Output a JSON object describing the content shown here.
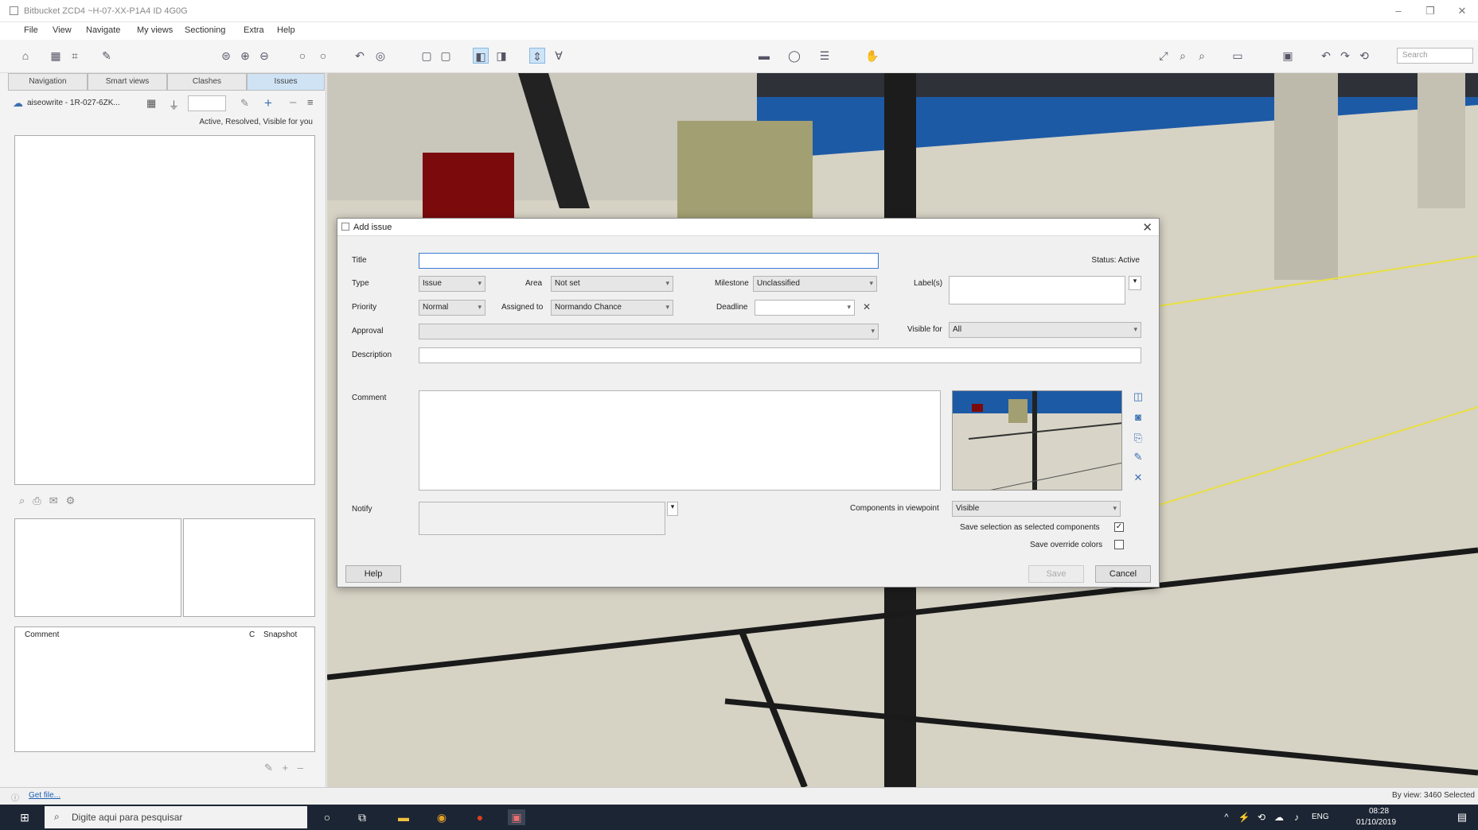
{
  "window": {
    "title": "Bitbucket ZCD4 ~H-07-XX-P1A4 ID 4G0G"
  },
  "menu": [
    "File",
    "View",
    "Navigate",
    "My views",
    "Sectioning",
    "Extra",
    "Help"
  ],
  "toolbar": {
    "search_placeholder": "Search"
  },
  "left_panel": {
    "tabs": [
      "Navigation",
      "Smart views",
      "Clashes",
      "Issues"
    ],
    "model_label": "aiseowrite - 1R-027-6ZK...",
    "filter_text": "Active, Resolved, Visible for you",
    "comment_header": "Comment",
    "comment_col2": "C",
    "snapshot_header": "Snapshot"
  },
  "dialog": {
    "title": "Add issue",
    "status": "Status: Active",
    "labels": {
      "title": "Title",
      "type": "Type",
      "area": "Area",
      "milestone": "Milestone",
      "labels": "Label(s)",
      "priority": "Priority",
      "assigned_to": "Assigned to",
      "deadline": "Deadline",
      "approval": "Approval",
      "visible_for": "Visible for",
      "description": "Description",
      "comment": "Comment",
      "notify": "Notify",
      "components": "Components in viewpoint",
      "save_selection": "Save selection as selected components",
      "save_colors": "Save override colors"
    },
    "values": {
      "type": "Issue",
      "area": "Not set",
      "milestone": "Unclassified",
      "priority": "Normal",
      "assigned_to": "Normando Chance",
      "visible_for": "All",
      "components": "Visible"
    },
    "buttons": {
      "help": "Help",
      "save": "Save",
      "cancel": "Cancel"
    }
  },
  "statusbar": {
    "link": "Get file...",
    "right_text": "By view: 3460 Selected"
  },
  "taskbar": {
    "search_placeholder": "Digite aqui para pesquisar",
    "lang": "ENG",
    "time": "08:28",
    "date": "01/10/2019"
  }
}
